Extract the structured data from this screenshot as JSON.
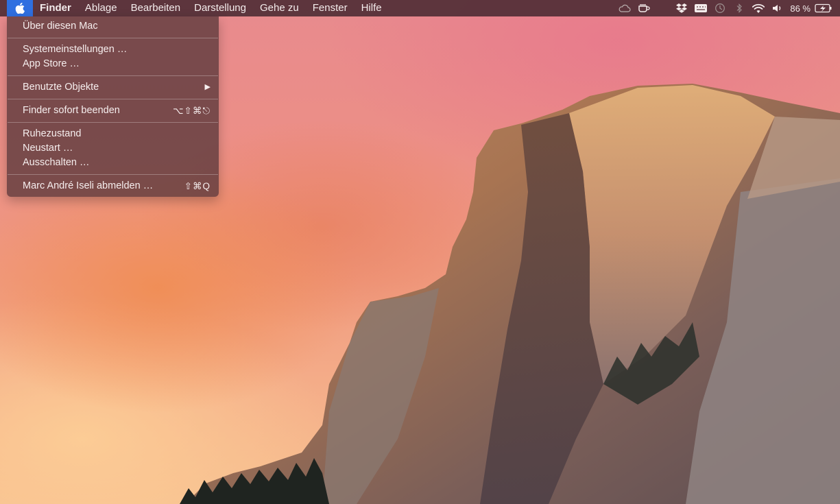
{
  "menubar": {
    "apple_menu_icon": "apple-logo-icon",
    "menus": [
      {
        "label": "Finder"
      },
      {
        "label": "Ablage"
      },
      {
        "label": "Bearbeiten"
      },
      {
        "label": "Darstellung"
      },
      {
        "label": "Gehe zu"
      },
      {
        "label": "Fenster"
      },
      {
        "label": "Hilfe"
      }
    ],
    "status": {
      "icons": [
        "cloud-icon",
        "cup-icon",
        "dropbox-icon",
        "keyboard-icon",
        "time-machine-icon",
        "bluetooth-icon",
        "wifi-icon",
        "volume-icon"
      ],
      "battery_percent": "86 %",
      "battery_icon": "battery-charging-icon"
    }
  },
  "apple_menu": {
    "items": [
      {
        "label": "Über diesen Mac"
      },
      {
        "label": "Systemeinstellungen …"
      },
      {
        "label": "App Store …"
      },
      {
        "label": "Benutzte Objekte",
        "submenu_arrow": "▶"
      },
      {
        "label": "Finder sofort beenden",
        "shortcut": "⌥⇧⌘⎋"
      },
      {
        "label": "Ruhezustand"
      },
      {
        "label": "Neustart …"
      },
      {
        "label": "Ausschalten …"
      },
      {
        "label": "Marc André Iseli abmelden …",
        "shortcut": "⇧⌘Q"
      }
    ]
  },
  "colors": {
    "menubar_bg": "#46283099",
    "apple_highlight": "#2f6fe0",
    "menu_text": "#f6eeee"
  }
}
